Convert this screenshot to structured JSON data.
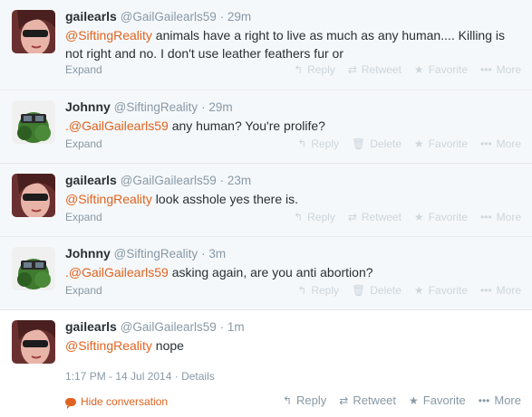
{
  "tweets": [
    {
      "name": "gailearls",
      "handle": "@GailGailearls59",
      "time": "29m",
      "mention": "@SiftingReality",
      "prefix": "",
      "text_line1": " animals have a right to live as much as any human....  Killing is",
      "text_line2": "not right and no. I don't use leather feathers fur or",
      "expand": "Expand"
    },
    {
      "name": "Johnny",
      "handle": "@SiftingReality",
      "time": "29m",
      "prefix": ".",
      "mention": "@GailGailearls59",
      "text_line1": " any human? You're prolife?",
      "expand": "Expand"
    },
    {
      "name": "gailearls",
      "handle": "@GailGailearls59",
      "time": "23m",
      "prefix": "",
      "mention": "@SiftingReality",
      "text_line1": " look asshole yes there is.",
      "expand": "Expand"
    },
    {
      "name": "Johnny",
      "handle": "@SiftingReality",
      "time": "3m",
      "prefix": ".",
      "mention": "@GailGailearls59",
      "text_line1": " asking again, are you anti abortion?",
      "expand": "Expand"
    },
    {
      "name": "gailearls",
      "handle": "@GailGailearls59",
      "time": "1m",
      "prefix": "",
      "mention": "@SiftingReality",
      "text_line1": " nope",
      "timestamp": "1:17 PM - 14 Jul 2014",
      "details": "Details",
      "hide": "Hide conversation"
    }
  ],
  "actions": {
    "reply": "Reply",
    "retweet": "Retweet",
    "delete": "Delete",
    "favorite": "Favorite",
    "more": "More",
    "sep": " · "
  },
  "colors": {
    "link": "#e0631f",
    "muted": "#8899a6",
    "faded": "#ccd6dd",
    "text": "#292f33"
  }
}
